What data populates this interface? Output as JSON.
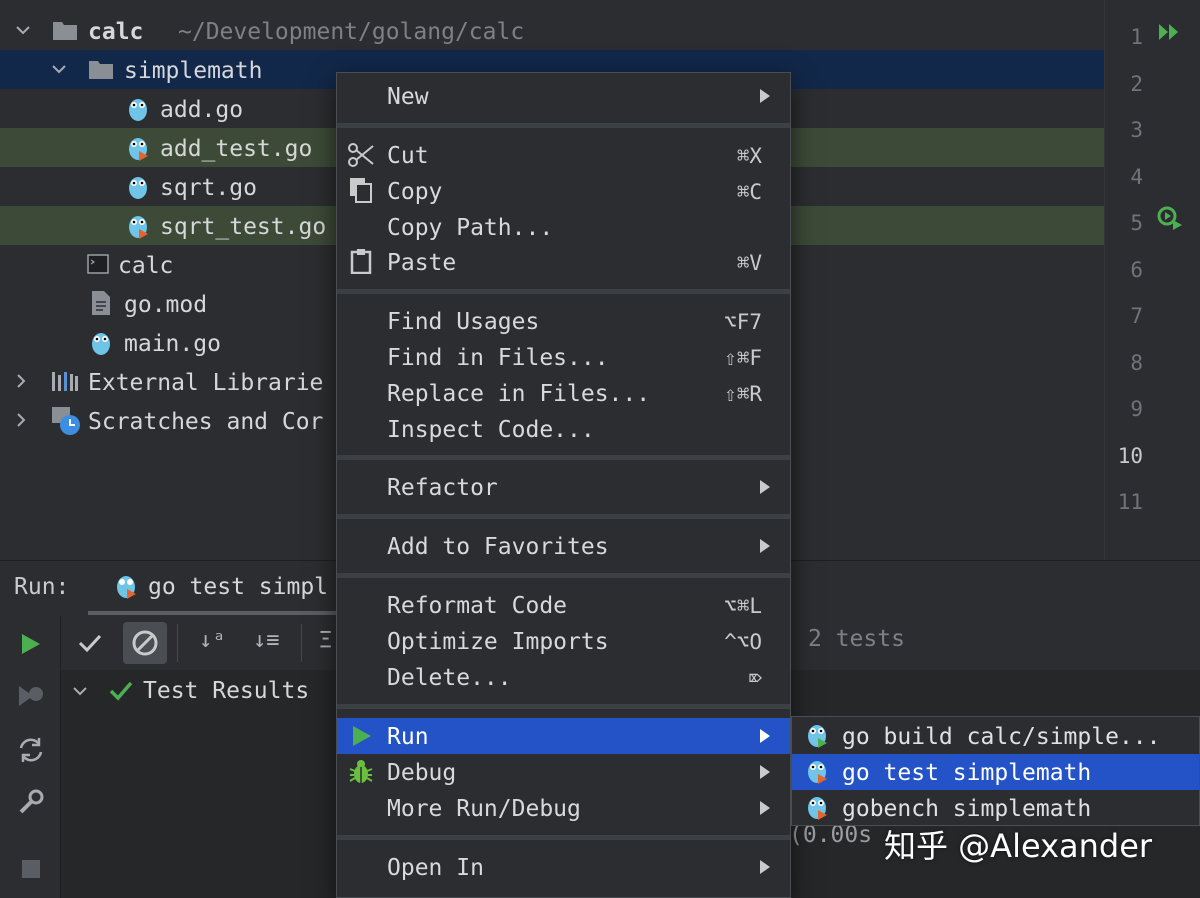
{
  "project": {
    "root_label": "calc",
    "root_path": "~/Development/golang/calc",
    "items": [
      {
        "label": "simplemath"
      },
      {
        "label": "add.go"
      },
      {
        "label": "add_test.go"
      },
      {
        "label": "sqrt.go"
      },
      {
        "label": "sqrt_test.go"
      },
      {
        "label": "calc"
      },
      {
        "label": "go.mod"
      },
      {
        "label": "main.go"
      },
      {
        "label": "External Librarie"
      },
      {
        "label": "Scratches and Cor"
      }
    ]
  },
  "gutter": {
    "lines": [
      "1",
      "2",
      "3",
      "4",
      "5",
      "6",
      "7",
      "8",
      "9",
      "10",
      "11"
    ]
  },
  "run": {
    "label": "Run:",
    "tab": "go test simpl",
    "status": "2 tests",
    "tree_root": "Test Results",
    "output_fragment": "(0.00s"
  },
  "menu": {
    "new": "New",
    "cut": "Cut",
    "cut_sc": "⌘X",
    "copy": "Copy",
    "copy_sc": "⌘C",
    "copy_path": "Copy Path...",
    "paste": "Paste",
    "paste_sc": "⌘V",
    "find_usages": "Find Usages",
    "find_usages_sc": "⌥F7",
    "find_in_files": "Find in Files...",
    "find_in_files_sc": "⇧⌘F",
    "replace_in_files": "Replace in Files...",
    "replace_in_files_sc": "⇧⌘R",
    "inspect_code": "Inspect Code...",
    "refactor": "Refactor",
    "add_to_favorites": "Add to Favorites",
    "reformat_code": "Reformat Code",
    "reformat_code_sc": "⌥⌘L",
    "optimize_imports": "Optimize Imports",
    "optimize_imports_sc": "^⌥O",
    "delete": "Delete...",
    "delete_sc": "⌦",
    "run": "Run",
    "debug": "Debug",
    "more_run_debug": "More Run/Debug",
    "open_in": "Open In"
  },
  "submenu": {
    "items": [
      {
        "label": "go build calc/simple..."
      },
      {
        "label": "go test simplemath"
      },
      {
        "label": "gobench simplemath"
      }
    ]
  },
  "watermark": "知乎 @Alexander",
  "colors": {
    "selection": "#12284a",
    "test_row": "#3d4a37",
    "menu_active": "#2453c8",
    "run_green": "#4caf50"
  }
}
